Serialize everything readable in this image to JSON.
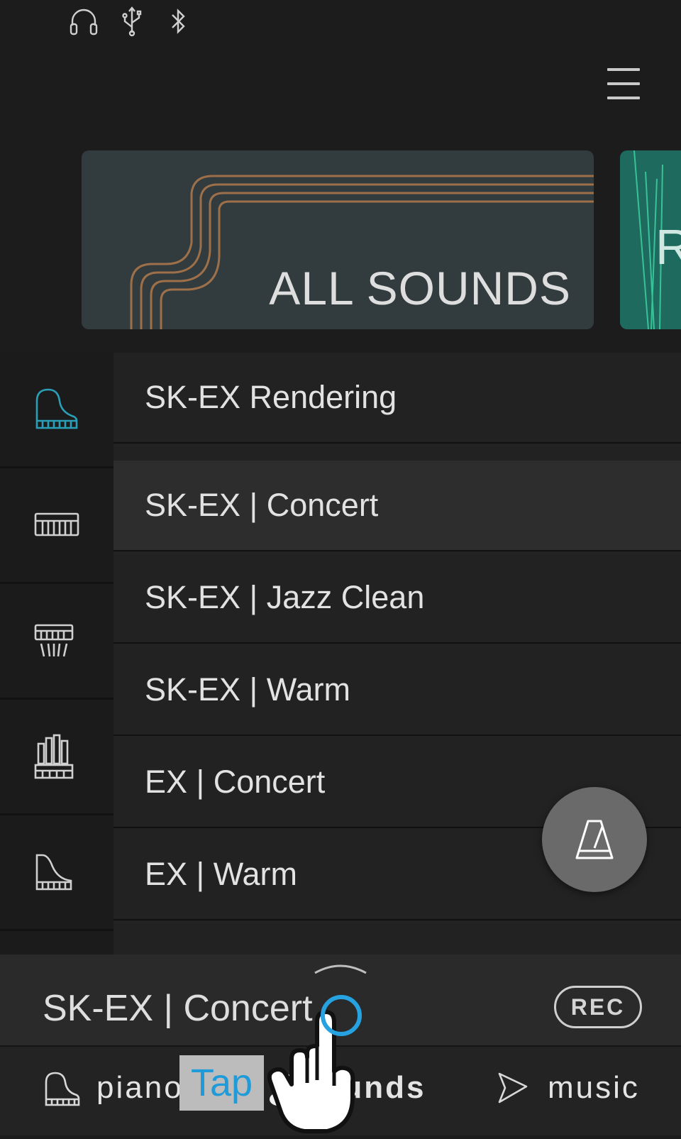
{
  "status_bar": {
    "icons": [
      "headphones-icon",
      "usb-icon",
      "bluetooth-icon"
    ]
  },
  "header": {
    "menu_icon": "hamburger-menu-icon"
  },
  "carousel": {
    "cards": [
      {
        "label": "ALL SOUNDS",
        "background": "#323b3e"
      },
      {
        "label": "R",
        "background": "#1e6a5e"
      }
    ]
  },
  "categories": [
    {
      "icon": "grand-piano-icon",
      "active": true
    },
    {
      "icon": "keyboard-icon",
      "active": false
    },
    {
      "icon": "electric-piano-icon",
      "active": false
    },
    {
      "icon": "organ-pipes-icon",
      "active": false
    },
    {
      "icon": "harpsichord-icon",
      "active": false
    }
  ],
  "sounds": [
    {
      "label": "SK-EX Rendering",
      "selected": false
    },
    {
      "label": "SK-EX | Concert",
      "selected": true
    },
    {
      "label": "SK-EX | Jazz Clean",
      "selected": false
    },
    {
      "label": "SK-EX | Warm",
      "selected": false
    },
    {
      "label": "EX | Concert",
      "selected": false
    },
    {
      "label": "EX | Warm",
      "selected": false
    }
  ],
  "metronome": {
    "icon": "metronome-icon"
  },
  "now_playing": {
    "current_sound": "SK-EX | Concert",
    "rec_label": "REC"
  },
  "bottom_nav": {
    "items": [
      {
        "label": "piano",
        "icon": "grand-piano-icon"
      },
      {
        "label": "sounds",
        "icon": "music-note-icon"
      },
      {
        "label": "music",
        "icon": "play-icon"
      }
    ]
  },
  "overlay": {
    "tap_label": "Tap"
  },
  "colors": {
    "accent": "#2aa0b8",
    "tap_highlight": "#1e9bd8"
  }
}
